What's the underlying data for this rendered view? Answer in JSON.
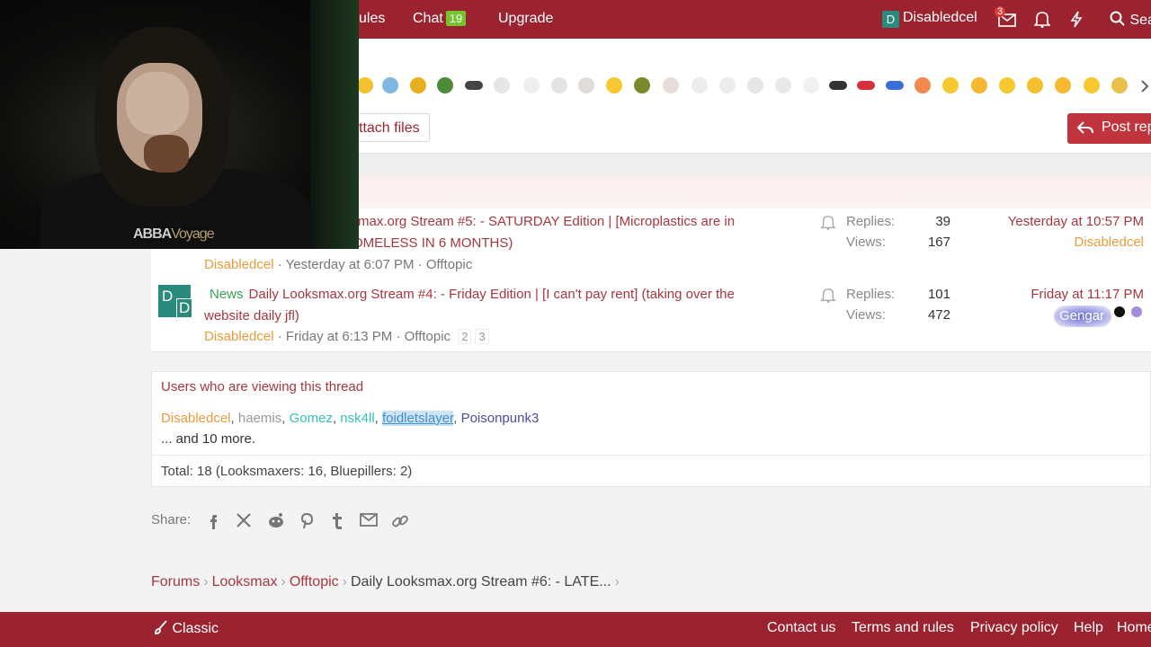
{
  "nav": {
    "rules": "ules",
    "chat_label": "Chat",
    "chat_count": "19",
    "upgrade": "Upgrade",
    "user_initial": "D",
    "username": "Disabledcel",
    "inbox_badge": "3",
    "search": "Sea"
  },
  "editor": {
    "attach_label": "ttach files",
    "post_label": "Post rep"
  },
  "threads": [
    {
      "title_line1": "max.org Stream #5: - SATURDAY Edition | [Microplastics are in",
      "title_line2": "OMELESS IN 6 MONTHS)",
      "author": "Disabledcel",
      "date": "Yesterday at 6:07 PM",
      "forum": "Offtopic",
      "replies_label": "Replies:",
      "replies": "39",
      "views_label": "Views:",
      "views": "167",
      "last_date": "Yesterday at 10:57 PM",
      "last_user": "Disabledcel"
    },
    {
      "prefix": "News",
      "title_line1": "Daily Looksmax.org Stream #4: - Friday Edition | [I can't pay rent] (taking over the",
      "title_line2": "website daily jfl)",
      "author": "Disabledcel",
      "date": "Friday at 6:13 PM",
      "forum": "Offtopic",
      "page2": "2",
      "page3": "3",
      "replies_label": "Replies:",
      "replies": "101",
      "views_label": "Views:",
      "views": "472",
      "last_date": "Friday at 11:17 PM",
      "last_user": "Gengar",
      "avatar_l1": "D",
      "avatar_l2": "D"
    }
  ],
  "viewers": {
    "heading": "Users who are viewing this thread",
    "users": [
      "Disabledcel",
      "haemis",
      "Gomez",
      "nsk4ll",
      "foidletslayer",
      "Poisonpunk3"
    ],
    "more": "... and 10 more.",
    "total": "Total: 18 (Looksmaxers: 16, Bluepillers: 2)"
  },
  "share": {
    "label": "Share:",
    "icons": [
      "facebook-icon",
      "x-icon",
      "reddit-icon",
      "pinterest-icon",
      "tumblr-icon",
      "email-icon",
      "link-icon"
    ]
  },
  "breadcrumb": {
    "items": [
      "Forums",
      "Looksmax",
      "Offtopic"
    ],
    "current": "Daily Looksmax.org Stream #6: - LATE..."
  },
  "footer": {
    "style": "Classic",
    "contact": "Contact us",
    "terms": "Terms and rules",
    "privacy": "Privacy policy",
    "help": "Help",
    "home": "Home"
  },
  "webcam": {
    "overlay_bold": "ABBA",
    "overlay_light": "Voyage"
  },
  "colors": {
    "brand": "#9b2330",
    "link": "#a8363f",
    "user_orange": "#e69c3c",
    "news_green": "#3aa054"
  }
}
